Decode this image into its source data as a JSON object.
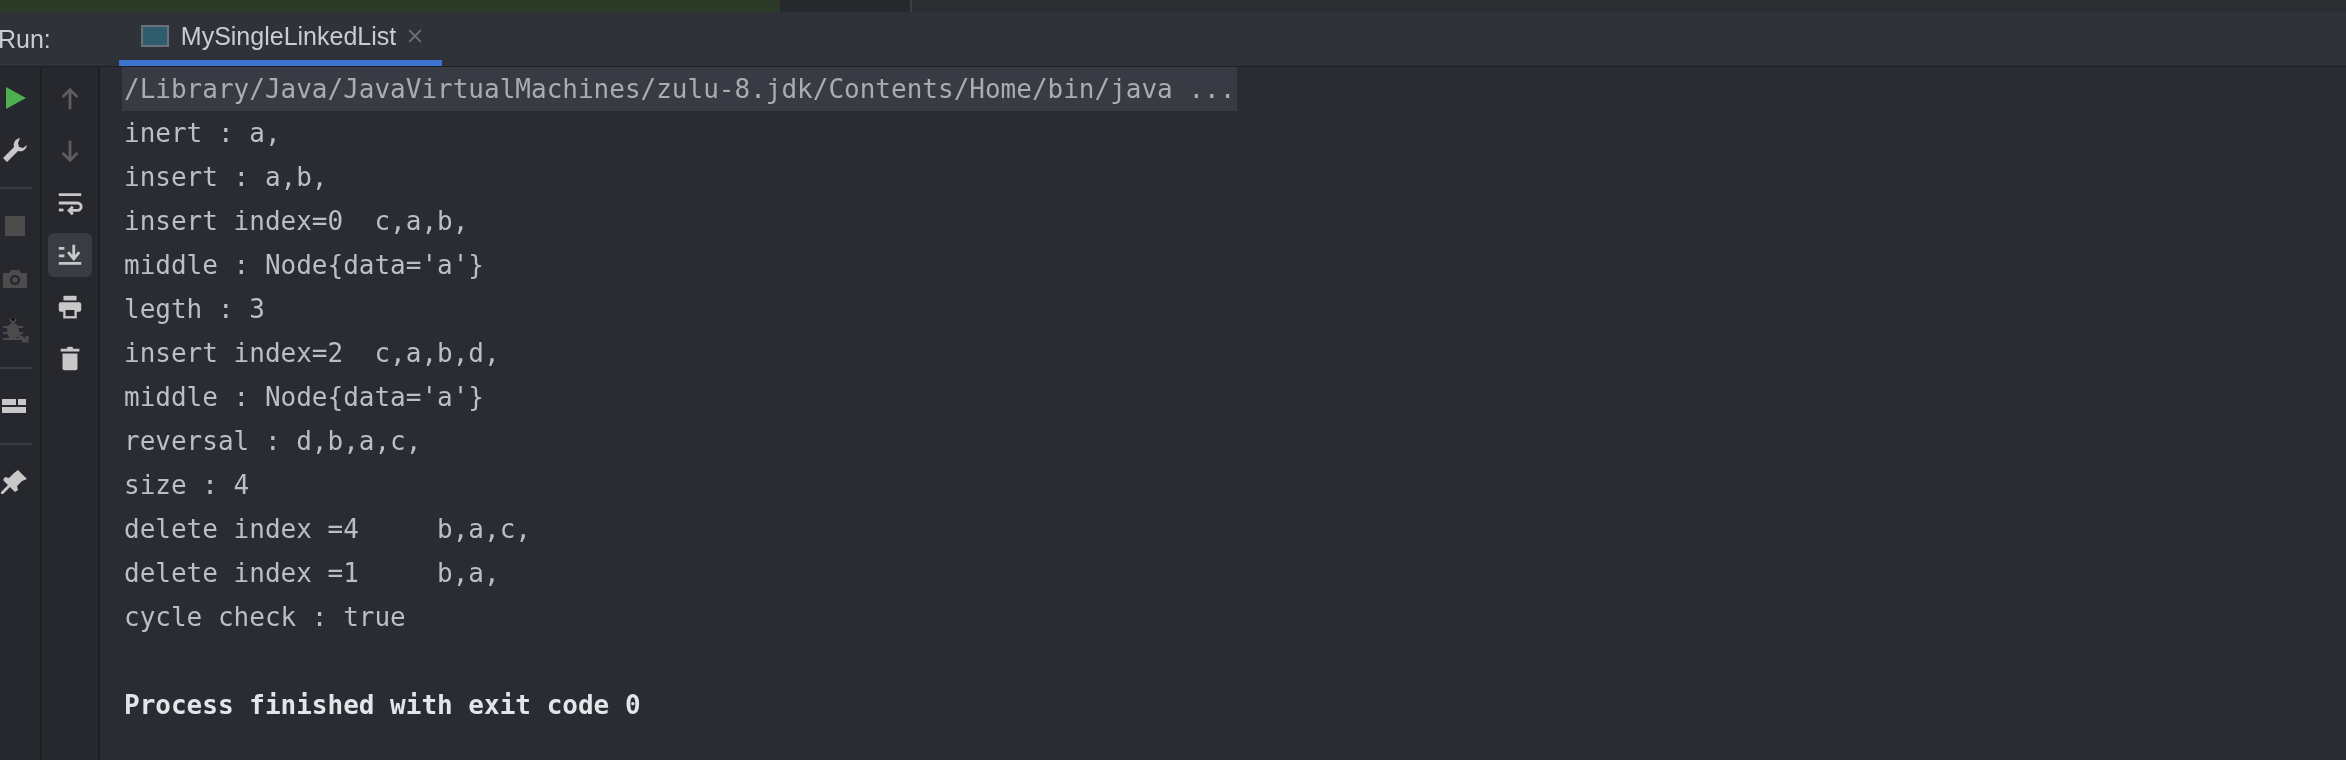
{
  "run_panel": {
    "label": "Run:",
    "tabs": [
      {
        "label": "MySingleLinkedList",
        "selected": true,
        "closable": true
      }
    ]
  },
  "left_toolbar": [
    {
      "kind": "run",
      "disabled": false
    },
    {
      "kind": "wrench",
      "disabled": false
    },
    {
      "kind": "separator"
    },
    {
      "kind": "stop",
      "disabled": true
    },
    {
      "kind": "camera",
      "disabled": true
    },
    {
      "kind": "bug",
      "disabled": true
    },
    {
      "kind": "separator"
    },
    {
      "kind": "layout",
      "disabled": false
    },
    {
      "kind": "separator"
    },
    {
      "kind": "pin",
      "disabled": false
    }
  ],
  "console_toolbar": [
    {
      "kind": "up",
      "disabled": true,
      "selected": false
    },
    {
      "kind": "down",
      "disabled": true,
      "selected": false
    },
    {
      "kind": "wrap",
      "disabled": false,
      "selected": false
    },
    {
      "kind": "scroll-end",
      "disabled": false,
      "selected": true
    },
    {
      "kind": "print",
      "disabled": false,
      "selected": false
    },
    {
      "kind": "trash",
      "disabled": false,
      "selected": false
    }
  ],
  "console": {
    "lines": [
      {
        "kind": "command",
        "text": "/Library/Java/JavaVirtualMachines/zulu-8.jdk/Contents/Home/bin/java ..."
      },
      {
        "kind": "output",
        "text": "inert : a,"
      },
      {
        "kind": "output",
        "text": "insert : a,b,"
      },
      {
        "kind": "output",
        "text": "insert index=0  c,a,b,"
      },
      {
        "kind": "output",
        "text": "middle : Node{data='a'}"
      },
      {
        "kind": "output",
        "text": "legth : 3"
      },
      {
        "kind": "output",
        "text": "insert index=2  c,a,b,d,"
      },
      {
        "kind": "output",
        "text": "middle : Node{data='a'}"
      },
      {
        "kind": "output",
        "text": "reversal : d,b,a,c,"
      },
      {
        "kind": "output",
        "text": "size : 4"
      },
      {
        "kind": "output",
        "text": "delete index =4     b,a,c,"
      },
      {
        "kind": "output",
        "text": "delete index =1     b,a,"
      },
      {
        "kind": "output",
        "text": "cycle check : true"
      },
      {
        "kind": "exit",
        "text": "Process finished with exit code 0"
      }
    ]
  }
}
